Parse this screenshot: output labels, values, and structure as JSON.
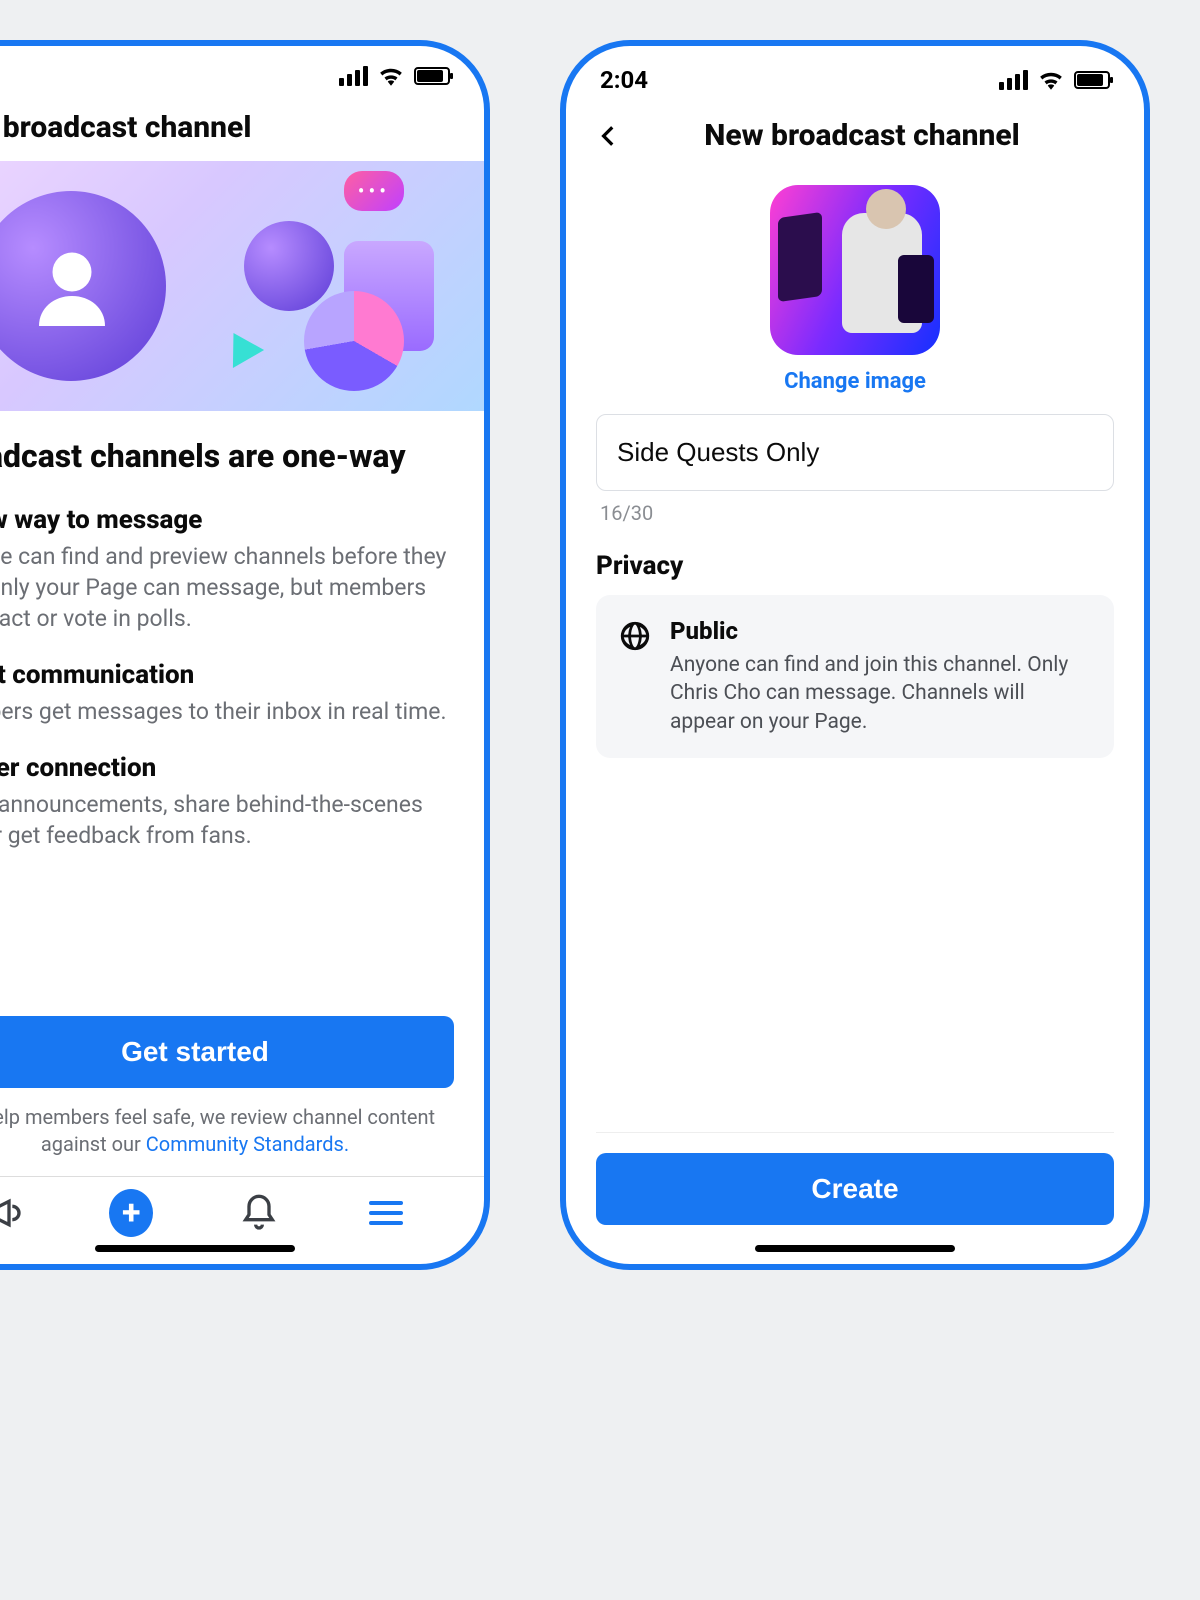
{
  "left": {
    "status": {
      "time": ""
    },
    "header_title": "New broadcast channel",
    "headline": "Broadcast channels are one-way",
    "features": [
      {
        "title": "A new way to message",
        "body": "Anyone can find and preview channels before they join. Only your Page can message, but members can react or vote in polls."
      },
      {
        "title": "Direct communication",
        "body": "Members get messages to their inbox in real time."
      },
      {
        "title": "Deeper connection",
        "body": "Make announcements, share behind-the-scenes info or get feedback from fans."
      }
    ],
    "cta_label": "Get started",
    "disclaimer_prefix": "To help members feel safe, we review channel content against our ",
    "disclaimer_link": "Community Standards."
  },
  "right": {
    "status": {
      "time": "2:04"
    },
    "header_title": "New broadcast channel",
    "change_image": "Change image",
    "name_value": "Side Quests Only",
    "char_count": "16/30",
    "privacy_label": "Privacy",
    "privacy_option": {
      "title": "Public",
      "body": "Anyone can find and join this channel. Only Chris Cho can message. Channels will appear on your Page."
    },
    "create_label": "Create"
  }
}
